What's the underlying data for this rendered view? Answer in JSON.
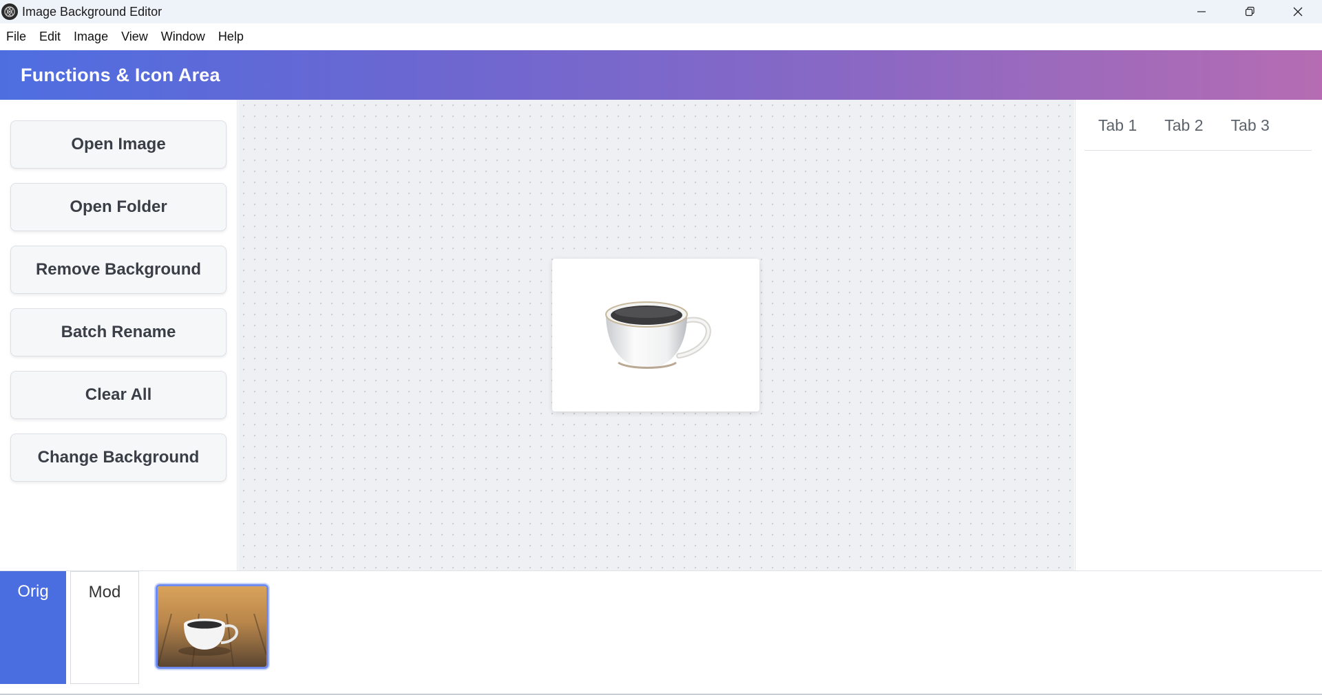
{
  "window": {
    "title": "Image Background Editor",
    "controls": [
      "minimize-icon",
      "restore-icon",
      "close-icon"
    ]
  },
  "menubar": {
    "items": [
      "File",
      "Edit",
      "Image",
      "View",
      "Window",
      "Help"
    ]
  },
  "header": {
    "title": "Functions & Icon Area"
  },
  "sidebar": {
    "buttons": [
      "Open Image",
      "Open Folder",
      "Remove Background",
      "Batch Rename",
      "Clear All",
      "Change Background"
    ]
  },
  "right_panel": {
    "tabs": [
      "Tab 1",
      "Tab 2",
      "Tab 3"
    ]
  },
  "bottom": {
    "orig_label": "Orig",
    "mod_label": "Mod"
  },
  "colors": {
    "accent": "#4a6ddf",
    "header_gradient_start": "#4e6ee0",
    "header_gradient_end": "#b56cb2"
  }
}
